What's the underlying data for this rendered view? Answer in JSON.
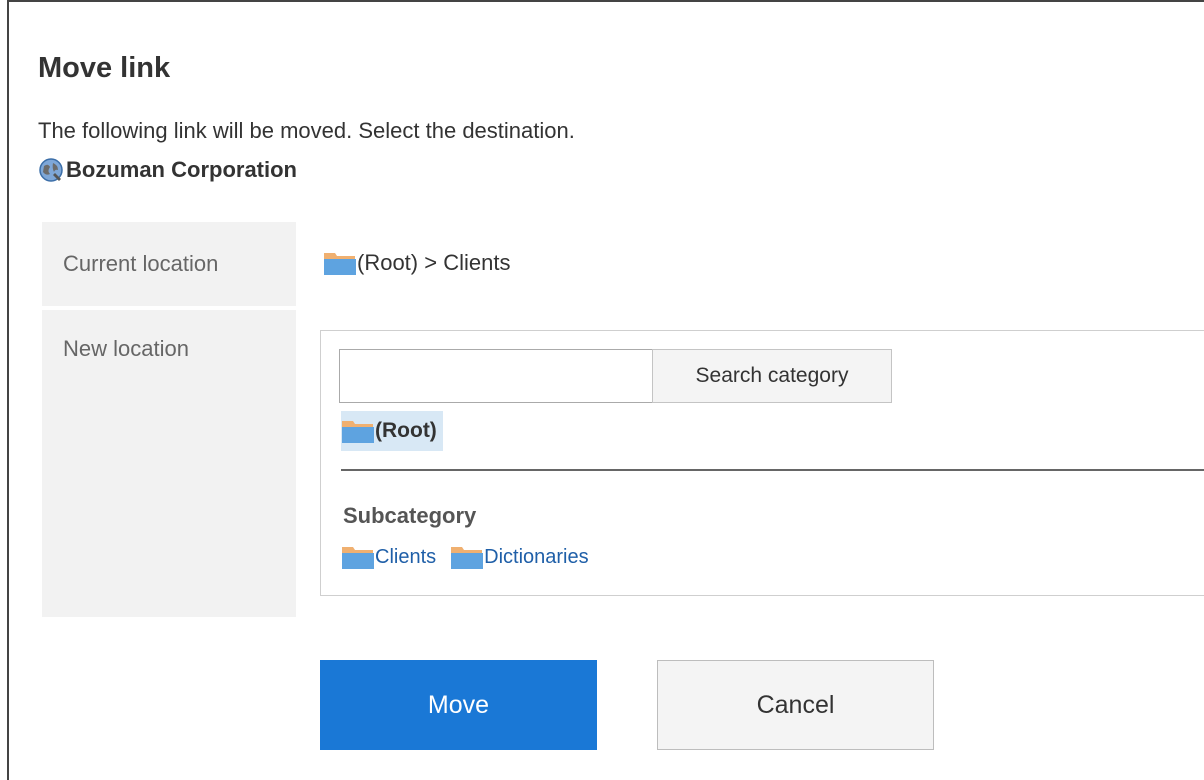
{
  "dialog": {
    "title": "Move link",
    "description": "The following link will be moved. Select the destination.",
    "link_name": "Bozuman Corporation",
    "link_icon": "globe-icon"
  },
  "current_location": {
    "label": "Current location",
    "value": "(Root) > Clients",
    "icon": "folder-icon"
  },
  "new_location": {
    "label": "New location",
    "search_input": {
      "value": "",
      "placeholder": ""
    },
    "search_button": "Search category",
    "selected_node": "(Root)",
    "subcategory_title": "Subcategory",
    "subcategories": [
      {
        "label": "Clients"
      },
      {
        "label": "Dictionaries"
      }
    ]
  },
  "buttons": {
    "move": "Move",
    "cancel": "Cancel"
  },
  "colors": {
    "primary": "#1a78d6",
    "link": "#1f5fa8",
    "selected_bg": "#d8e8f5",
    "label_bg": "#f2f2f2"
  }
}
